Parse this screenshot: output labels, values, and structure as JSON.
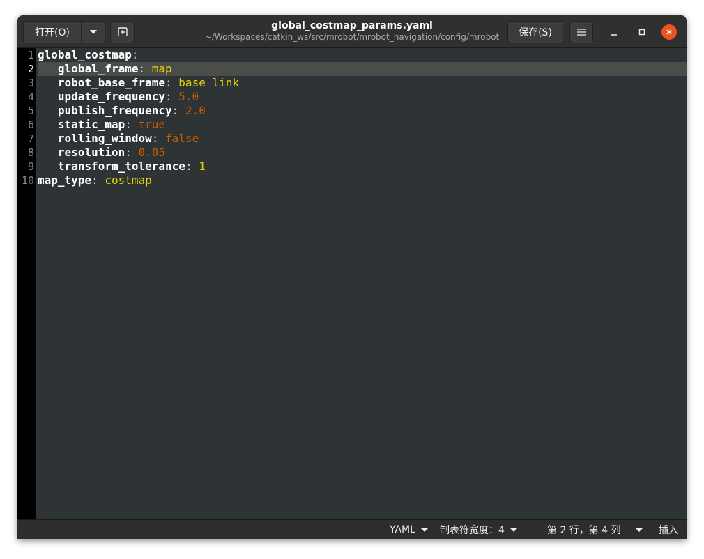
{
  "header": {
    "open_label": "打开(O)",
    "title": "global_costmap_params.yaml",
    "path": "~/Workspaces/catkin_ws/src/mrobot/mrobot_navigation/config/mrobot",
    "save_label": "保存(S)"
  },
  "editor": {
    "current_line": 2,
    "lines": [
      {
        "num": "1",
        "key": "global_costmap",
        "sep": ":",
        "value": "",
        "type": "none",
        "indent": ""
      },
      {
        "num": "2",
        "key": "global_frame",
        "sep": ": ",
        "value": "map",
        "type": "str",
        "indent": "   "
      },
      {
        "num": "3",
        "key": "robot_base_frame",
        "sep": ": ",
        "value": "base_link",
        "type": "str",
        "indent": "   "
      },
      {
        "num": "4",
        "key": "update_frequency",
        "sep": ": ",
        "value": "5.0",
        "type": "num",
        "indent": "   "
      },
      {
        "num": "5",
        "key": "publish_frequency",
        "sep": ": ",
        "value": "2.0",
        "type": "num",
        "indent": "   "
      },
      {
        "num": "6",
        "key": "static_map",
        "sep": ": ",
        "value": "true",
        "type": "bool",
        "indent": "   "
      },
      {
        "num": "7",
        "key": "rolling_window",
        "sep": ": ",
        "value": "false",
        "type": "bool",
        "indent": "   "
      },
      {
        "num": "8",
        "key": "resolution",
        "sep": ": ",
        "value": "0.05",
        "type": "num",
        "indent": "   "
      },
      {
        "num": "9",
        "key": "transform_tolerance",
        "sep": ": ",
        "value": "1",
        "type": "int",
        "indent": "   "
      },
      {
        "num": "10",
        "key": "map_type",
        "sep": ": ",
        "value": "costmap",
        "type": "str",
        "indent": ""
      }
    ]
  },
  "statusbar": {
    "language": "YAML",
    "tab_width": "制表符宽度：4",
    "cursor_pos": "第 2 行，第 4 列",
    "insert_mode": "插入"
  },
  "colors": {
    "accent_close": "#e95420",
    "string_value": "#edd400",
    "number_value": "#ce5c00"
  },
  "icons": {
    "open_dropdown": "chevron-down-icon",
    "new_tab": "new-tab-icon",
    "menu": "hamburger-menu-icon",
    "minimize": "minimize-icon",
    "maximize": "maximize-icon",
    "close": "close-icon"
  }
}
